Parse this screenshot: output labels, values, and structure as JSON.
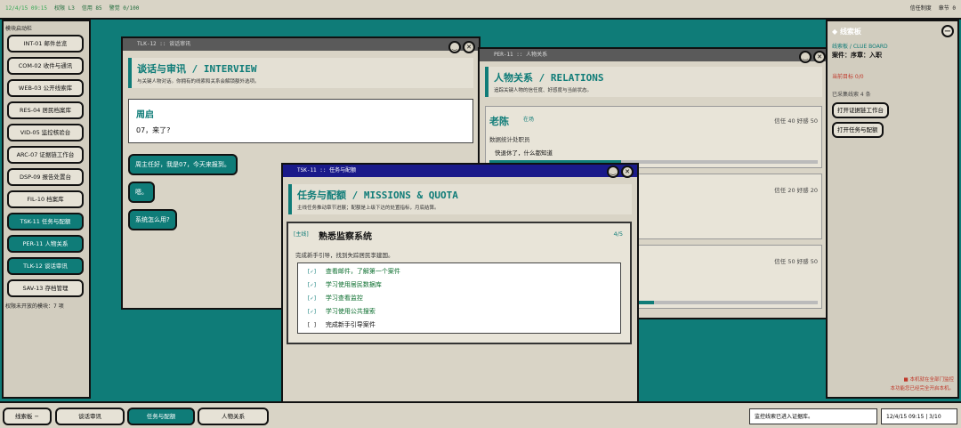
{
  "topbar": {
    "time": "12/4/15 09:15",
    "rank": "权限 L3",
    "credit": "信用 85",
    "alert": "警觉 0/100",
    "right1": "信任制度",
    "right2": "章节 0"
  },
  "sidebar": {
    "header": "模块启动栏",
    "items": [
      {
        "label": "INT-01 邮件总览",
        "active": false
      },
      {
        "label": "COM-02 收件与通讯",
        "active": false
      },
      {
        "label": "WEB-03 公开线索库",
        "active": false
      },
      {
        "label": "RES-04 居民档案库",
        "active": false
      },
      {
        "label": "VID-05 监控核验台",
        "active": false
      },
      {
        "label": "ARC-07 证据链工作台",
        "active": false
      },
      {
        "label": "DSP-09 报告处置台",
        "active": false
      },
      {
        "label": "FIL-10 档案库",
        "active": false
      },
      {
        "label": "TSK-11 任务与配额",
        "active": true
      },
      {
        "label": "PER-11 人物关系",
        "active": true
      },
      {
        "label": "TLK-12 谈话审讯",
        "active": true
      },
      {
        "label": "SAV-13 存档管理",
        "active": false
      }
    ],
    "footer": "权限未开放的模块：7 项"
  },
  "rpanel": {
    "title": "◆ 线索板",
    "collapse": "−",
    "subtitle": "线索板 / CLUE BOARD",
    "case": "案件：序章：入职",
    "goal": "当前目标 0/0",
    "clues": "已采集线索 4 条",
    "btn_evidence": "打开证据链工作台",
    "btn_tasks": "打开任务与配额",
    "warn1": "■ 本机就在全部门监控",
    "warn2": "本功能您已经完全开启本机。"
  },
  "taskbar": {
    "items": [
      {
        "label": "线索板 −",
        "active": false
      },
      {
        "label": "谈话审讯",
        "active": false
      },
      {
        "label": "任务与配额",
        "active": true
      },
      {
        "label": "人物关系",
        "active": false
      }
    ],
    "status": "监控线索已进入证据库。",
    "clock": "12/4/15 09:15 | 3/10"
  },
  "tlk": {
    "title": "TLK-12 :: 谈话审讯",
    "heading": "谈话与审讯 / INTERVIEW",
    "desc": "与关键人物对话。你拥有的线索和关系会解锁额外选项。",
    "speaker": "周启",
    "line": "07，来了?",
    "options": [
      "周主任好，我是07，今天来报到。",
      "嗯。",
      "系统怎么用?"
    ]
  },
  "per": {
    "title": "PER-11 :: 人物关系",
    "heading": "人物关系 / RELATIONS",
    "desc": "追踪关键人物的信任度、好感度与当前状态。",
    "person": {
      "name": "老陈",
      "tag": "在场",
      "role": "数据统计处职员",
      "quote": "快退休了，什么都知道",
      "stats": "信任 40  好感 50"
    },
    "row2_stats": "信任 20  好感 20",
    "row3_stats": "信任 50  好感 50"
  },
  "tsk": {
    "title": "TSK-11 :: 任务与配额",
    "heading": "任务与配额 / MISSIONS & QUOTA",
    "desc": "主线任务推动章节进展；配额是上级下达的处置指标，月底结算。",
    "mission": {
      "tag": "[主线]",
      "name": "熟悉监察系统",
      "progress": "4/5",
      "desc": "完成新手引导，找到失踪居民李建国。",
      "tasks": [
        {
          "box": "[✓]",
          "label": "查看邮件，了解第一个案件",
          "done": true
        },
        {
          "box": "[✓]",
          "label": "学习使用居民数据库",
          "done": true
        },
        {
          "box": "[✓]",
          "label": "学习查看监控",
          "done": true
        },
        {
          "box": "[✓]",
          "label": "学习使用公共搜索",
          "done": true
        },
        {
          "box": "[ ]",
          "label": "完成新手引导案件",
          "done": false
        }
      ]
    }
  },
  "colors": {
    "accent": "#0f7c78",
    "panel": "#d9d4c6",
    "active_title": "#1a1a8a",
    "warn": "#c0392b"
  }
}
